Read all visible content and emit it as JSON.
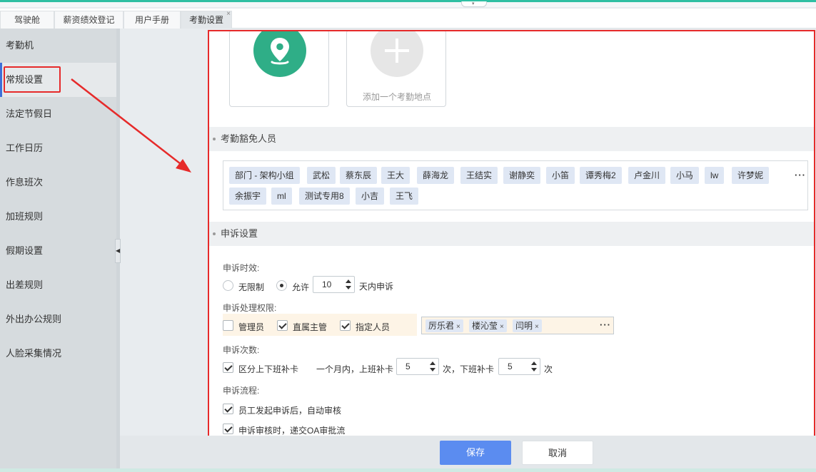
{
  "tabs": [
    {
      "label": "驾驶舱"
    },
    {
      "label": "薪资绩效登记"
    },
    {
      "label": "用户手册"
    },
    {
      "label": "考勤设置"
    }
  ],
  "tab_close_glyph": "×",
  "sidebar": {
    "items": [
      {
        "label": "考勤机"
      },
      {
        "label": "常规设置"
      },
      {
        "label": "法定节假日"
      },
      {
        "label": "工作日历"
      },
      {
        "label": "作息班次"
      },
      {
        "label": "加班规则"
      },
      {
        "label": "假期设置"
      },
      {
        "label": "出差规则"
      },
      {
        "label": "外出办公规则"
      },
      {
        "label": "人脸采集情况"
      }
    ],
    "active_index": 1
  },
  "locations": {
    "add_label": "添加一个考勤地点",
    "pin_color": "#2fae87",
    "icons": [
      "location-pin-icon",
      "plus-icon"
    ]
  },
  "exempt": {
    "title": "考勤豁免人员",
    "chips": [
      "部门 - 架构小组",
      "武松",
      "蔡东辰",
      "王大",
      "薛海龙",
      "王结实",
      "谢静奕",
      "小笛",
      "谭秀梅2",
      "卢金川",
      "小马",
      "lw",
      "许梦妮",
      "余振宇",
      "ml",
      "测试专用8",
      "小吉",
      "王飞"
    ],
    "more": "···"
  },
  "appeal": {
    "title": "申诉设置",
    "time_label": "申诉时效:",
    "unlimited": "无限制",
    "allow": "允许",
    "days_value": "10",
    "days_suffix": "天内申诉",
    "perm_label": "申诉处理权限:",
    "perm_admin": "管理员",
    "perm_direct": "直属主管",
    "perm_specified": "指定人员",
    "people": [
      "厉乐君",
      "楼沁莹",
      "闫明"
    ],
    "people_more": "···",
    "remove_glyph": "×",
    "count_label": "申诉次数:",
    "distinguish": "区分上下班补卡",
    "month_text": "一个月内，上班补卡",
    "on_count": "5",
    "times_off_text": "次，下班补卡",
    "off_count": "5",
    "times": "次",
    "flow_label": "申诉流程:",
    "flow_auto": "员工发起申诉后，自动审核",
    "flow_oa": "申诉审核时，递交OA审批流"
  },
  "footer": {
    "save": "保存",
    "cancel": "取消"
  },
  "colors": {
    "accent": "#5b8cf0",
    "highlight": "#e62a2a",
    "chip": "#dfe7f4"
  }
}
